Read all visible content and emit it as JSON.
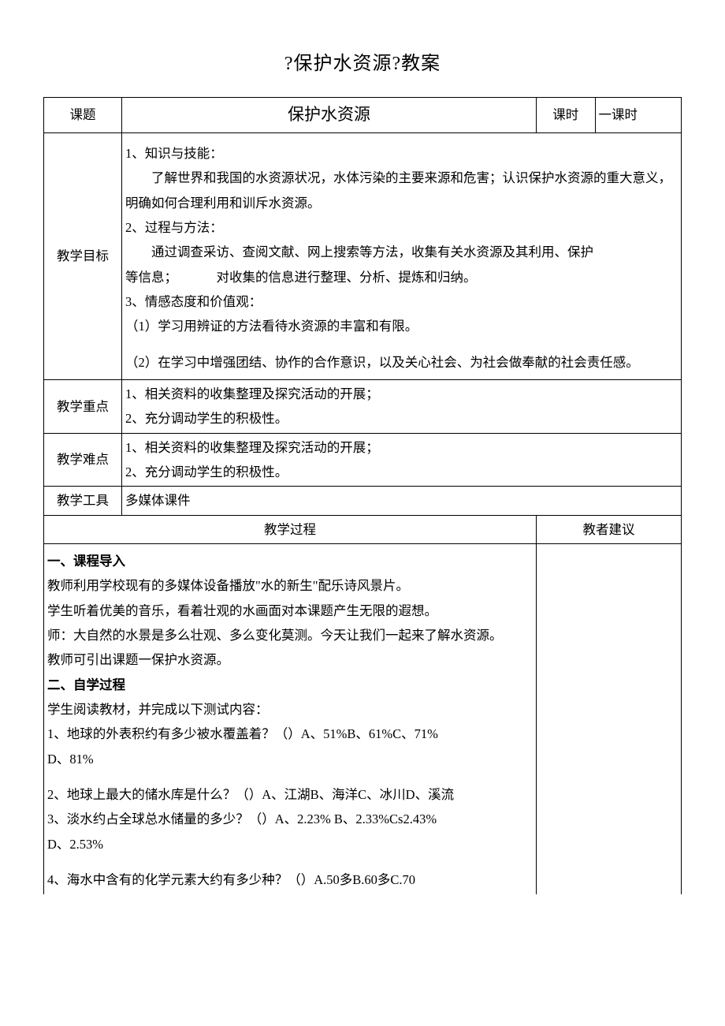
{
  "title": "?保护水资源?教案",
  "header": {
    "topic_label": "课题",
    "topic_value": "保护水资源",
    "period_label": "课时",
    "period_value": "一课时"
  },
  "objectives": {
    "label": "教学目标",
    "h1": "1、知识与技能：",
    "p1": "了解世界和我国的水资源状况，水体污染的主要来源和危害；认识保护水资源的重大意义，明确如何合理利用和训斥水资源。",
    "h2": "2、过程与方法：",
    "p2a": "通过调查采访、查阅文献、网上搜索等方法，收集有关水资源及其利用、保护",
    "p2b_a": "等信息；",
    "p2b_b": "对收集的信息进行整理、分析、提炼和归纳。",
    "h3": "3、情感态度和价值观：",
    "p3a": "（1）学习用辨证的方法看待水资源的丰富和有限。",
    "p3b": "（2）在学习中增强团结、协作的合作意识，以及关心社会、为社会做奉献的社会责任感。"
  },
  "keypoint": {
    "label": "教学重点",
    "l1": "1、相关资料的收集整理及探究活动的开展；",
    "l2": "2、充分调动学生的积极性。"
  },
  "difficulty": {
    "label": "教学难点",
    "l1": "1、相关资料的收集整理及探究活动的开展；",
    "l2": "2、充分调动学生的积极性。"
  },
  "tools": {
    "label": "教学工具",
    "value": "多媒体课件"
  },
  "process_header": {
    "left": "教学过程",
    "right": "教者建议"
  },
  "process": {
    "s1": "一、课程导入",
    "p1": "教师利用学校现有的多媒体设备播放\"水的新生\"配乐诗风景片。",
    "p2": "学生听着优美的音乐，看着壮观的水画面对本课题产生无限的遐想。",
    "p3": "师：大自然的水景是多么壮观、多么变化莫测。今天让我们一起来了解水资源。",
    "p4": "教师可引出课题一保护水资源。",
    "s2": "二、自学过程",
    "p5": "学生阅读教材，并完成以下测试内容：",
    "q1": "1、地球的外表积约有多少被水覆盖着？（）A、51%B、61%C、71%",
    "q1b": "D、81%",
    "q2": "2、地球上最大的储水库是什么？（）A、江湖B、海洋C、冰川D、溪流",
    "q3": "3、淡水约占全球总水储量的多少？（）A、2.23%  B、2.33%Cs2.43%",
    "q3b": "D、2.53%",
    "q4": "4、海水中含有的化学元素大约有多少种？（）A.50多B.60多C.70"
  }
}
